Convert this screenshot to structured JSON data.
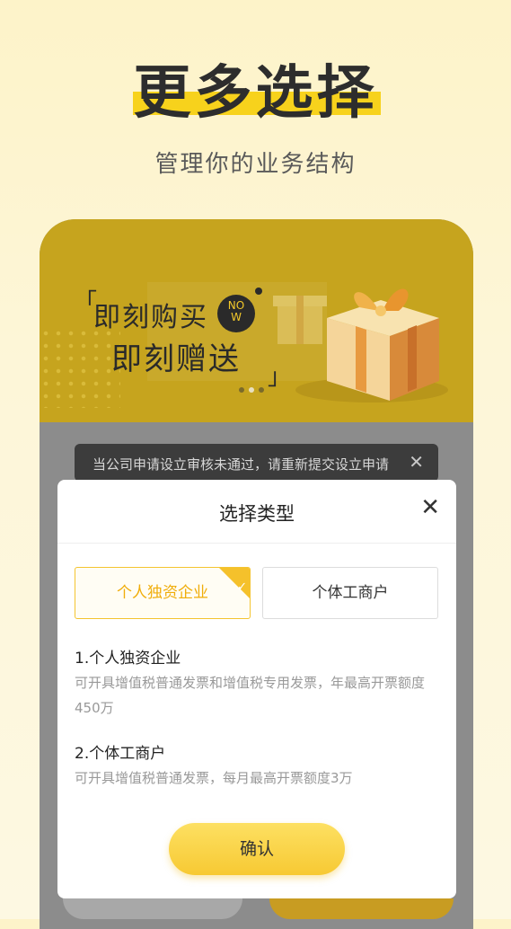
{
  "header": {
    "title": "更多选择",
    "subtitle": "管理你的业务结构"
  },
  "banner": {
    "bracket_open": "「",
    "line1": "即刻购买",
    "badge": "NOW",
    "line2": "即刻赠送",
    "bracket_close": "」",
    "pager_count": 3,
    "pager_active": 2
  },
  "toast": {
    "message": "当公司申请设立审核未通过，请重新提交设立申请",
    "close_icon": "close-icon"
  },
  "modal": {
    "title": "选择类型",
    "close_icon": "close-icon",
    "options": [
      {
        "label": "个人独资企业",
        "selected": true
      },
      {
        "label": "个体工商户",
        "selected": false
      }
    ],
    "descriptions": [
      {
        "heading": "1.个人独资企业",
        "text": "可开具增值税普通发票和增值税专用发票，年最高开票额度450万"
      },
      {
        "heading": "2.个体工商户",
        "text": "可开具增值税普通发票，每月最高开票额度3万"
      }
    ],
    "confirm_label": "确认"
  },
  "colors": {
    "accent": "#f7d21c",
    "selected_text": "#f0ad0a",
    "banner": "#c6a41e"
  }
}
